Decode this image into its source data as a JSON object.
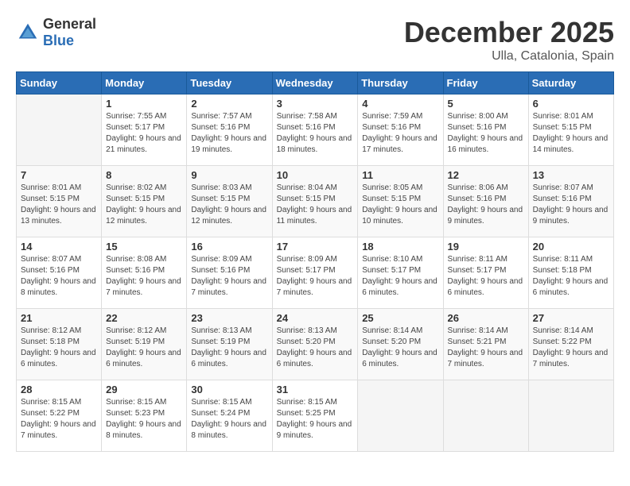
{
  "logo": {
    "general": "General",
    "blue": "Blue"
  },
  "title": {
    "month_year": "December 2025",
    "location": "Ulla, Catalonia, Spain"
  },
  "days_of_week": [
    "Sunday",
    "Monday",
    "Tuesday",
    "Wednesday",
    "Thursday",
    "Friday",
    "Saturday"
  ],
  "weeks": [
    [
      {
        "day": "",
        "info": ""
      },
      {
        "day": "1",
        "info": "Sunrise: 7:55 AM\nSunset: 5:17 PM\nDaylight: 9 hours\nand 21 minutes."
      },
      {
        "day": "2",
        "info": "Sunrise: 7:57 AM\nSunset: 5:16 PM\nDaylight: 9 hours\nand 19 minutes."
      },
      {
        "day": "3",
        "info": "Sunrise: 7:58 AM\nSunset: 5:16 PM\nDaylight: 9 hours\nand 18 minutes."
      },
      {
        "day": "4",
        "info": "Sunrise: 7:59 AM\nSunset: 5:16 PM\nDaylight: 9 hours\nand 17 minutes."
      },
      {
        "day": "5",
        "info": "Sunrise: 8:00 AM\nSunset: 5:16 PM\nDaylight: 9 hours\nand 16 minutes."
      },
      {
        "day": "6",
        "info": "Sunrise: 8:01 AM\nSunset: 5:15 PM\nDaylight: 9 hours\nand 14 minutes."
      }
    ],
    [
      {
        "day": "7",
        "info": "Sunrise: 8:01 AM\nSunset: 5:15 PM\nDaylight: 9 hours\nand 13 minutes."
      },
      {
        "day": "8",
        "info": "Sunrise: 8:02 AM\nSunset: 5:15 PM\nDaylight: 9 hours\nand 12 minutes."
      },
      {
        "day": "9",
        "info": "Sunrise: 8:03 AM\nSunset: 5:15 PM\nDaylight: 9 hours\nand 12 minutes."
      },
      {
        "day": "10",
        "info": "Sunrise: 8:04 AM\nSunset: 5:15 PM\nDaylight: 9 hours\nand 11 minutes."
      },
      {
        "day": "11",
        "info": "Sunrise: 8:05 AM\nSunset: 5:15 PM\nDaylight: 9 hours\nand 10 minutes."
      },
      {
        "day": "12",
        "info": "Sunrise: 8:06 AM\nSunset: 5:16 PM\nDaylight: 9 hours\nand 9 minutes."
      },
      {
        "day": "13",
        "info": "Sunrise: 8:07 AM\nSunset: 5:16 PM\nDaylight: 9 hours\nand 9 minutes."
      }
    ],
    [
      {
        "day": "14",
        "info": "Sunrise: 8:07 AM\nSunset: 5:16 PM\nDaylight: 9 hours\nand 8 minutes."
      },
      {
        "day": "15",
        "info": "Sunrise: 8:08 AM\nSunset: 5:16 PM\nDaylight: 9 hours\nand 7 minutes."
      },
      {
        "day": "16",
        "info": "Sunrise: 8:09 AM\nSunset: 5:16 PM\nDaylight: 9 hours\nand 7 minutes."
      },
      {
        "day": "17",
        "info": "Sunrise: 8:09 AM\nSunset: 5:17 PM\nDaylight: 9 hours\nand 7 minutes."
      },
      {
        "day": "18",
        "info": "Sunrise: 8:10 AM\nSunset: 5:17 PM\nDaylight: 9 hours\nand 6 minutes."
      },
      {
        "day": "19",
        "info": "Sunrise: 8:11 AM\nSunset: 5:17 PM\nDaylight: 9 hours\nand 6 minutes."
      },
      {
        "day": "20",
        "info": "Sunrise: 8:11 AM\nSunset: 5:18 PM\nDaylight: 9 hours\nand 6 minutes."
      }
    ],
    [
      {
        "day": "21",
        "info": "Sunrise: 8:12 AM\nSunset: 5:18 PM\nDaylight: 9 hours\nand 6 minutes."
      },
      {
        "day": "22",
        "info": "Sunrise: 8:12 AM\nSunset: 5:19 PM\nDaylight: 9 hours\nand 6 minutes."
      },
      {
        "day": "23",
        "info": "Sunrise: 8:13 AM\nSunset: 5:19 PM\nDaylight: 9 hours\nand 6 minutes."
      },
      {
        "day": "24",
        "info": "Sunrise: 8:13 AM\nSunset: 5:20 PM\nDaylight: 9 hours\nand 6 minutes."
      },
      {
        "day": "25",
        "info": "Sunrise: 8:14 AM\nSunset: 5:20 PM\nDaylight: 9 hours\nand 6 minutes."
      },
      {
        "day": "26",
        "info": "Sunrise: 8:14 AM\nSunset: 5:21 PM\nDaylight: 9 hours\nand 7 minutes."
      },
      {
        "day": "27",
        "info": "Sunrise: 8:14 AM\nSunset: 5:22 PM\nDaylight: 9 hours\nand 7 minutes."
      }
    ],
    [
      {
        "day": "28",
        "info": "Sunrise: 8:15 AM\nSunset: 5:22 PM\nDaylight: 9 hours\nand 7 minutes."
      },
      {
        "day": "29",
        "info": "Sunrise: 8:15 AM\nSunset: 5:23 PM\nDaylight: 9 hours\nand 8 minutes."
      },
      {
        "day": "30",
        "info": "Sunrise: 8:15 AM\nSunset: 5:24 PM\nDaylight: 9 hours\nand 8 minutes."
      },
      {
        "day": "31",
        "info": "Sunrise: 8:15 AM\nSunset: 5:25 PM\nDaylight: 9 hours\nand 9 minutes."
      },
      {
        "day": "",
        "info": ""
      },
      {
        "day": "",
        "info": ""
      },
      {
        "day": "",
        "info": ""
      }
    ]
  ]
}
